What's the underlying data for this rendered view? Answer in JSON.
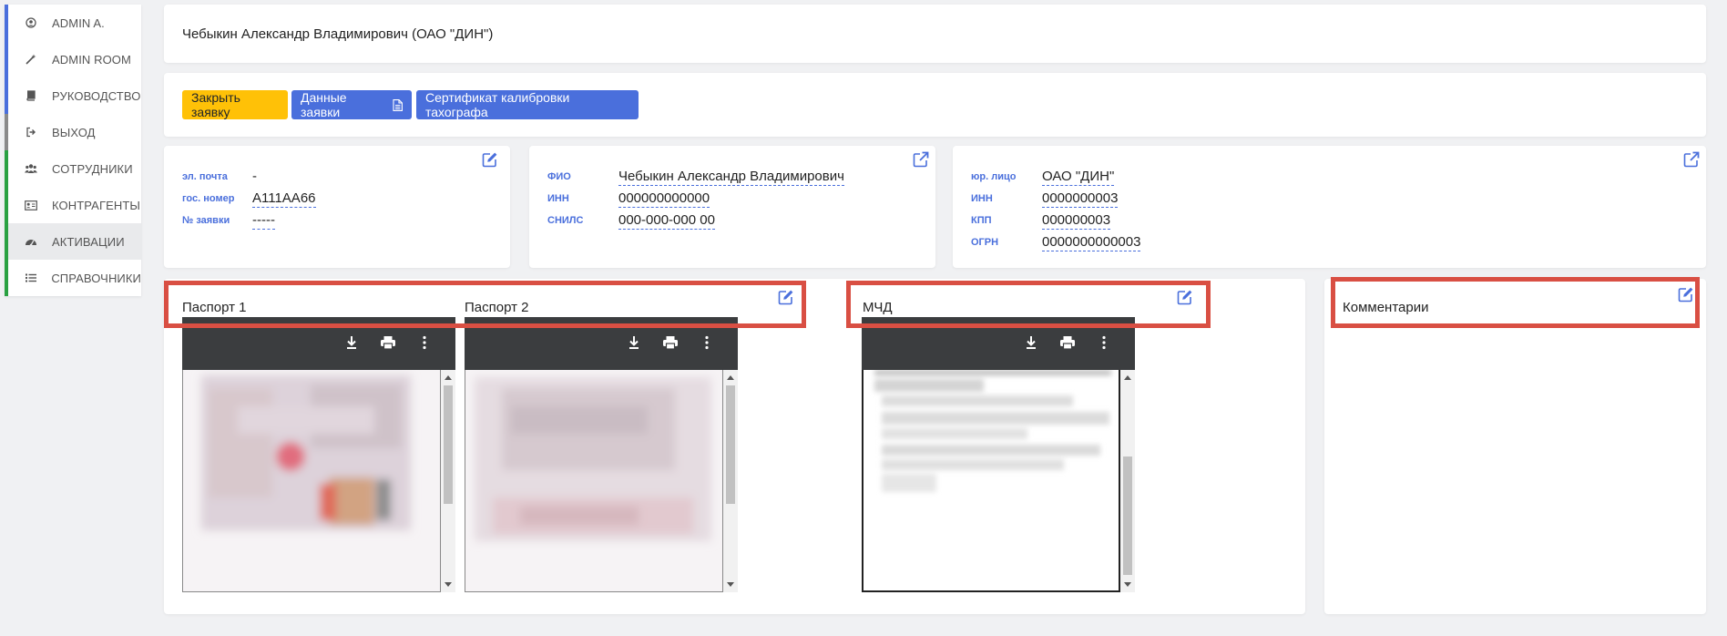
{
  "sidebar": {
    "items": [
      {
        "label": "ADMIN A.",
        "icon": "user-circle-icon",
        "bar": "#4a6fdc"
      },
      {
        "label": "ADMIN ROOM",
        "icon": "magic-wand-icon",
        "bar": "#4a6fdc"
      },
      {
        "label": "РУКОВОДСТВО",
        "icon": "book-icon",
        "bar": "#4a6fdc"
      },
      {
        "label": "ВЫХОД",
        "icon": "sign-out-icon",
        "bar": "#8a8a8a"
      },
      {
        "label": "СОТРУДНИКИ",
        "icon": "users-icon",
        "bar": "#2aa142"
      },
      {
        "label": "КОНТРАГЕНТЫ",
        "icon": "id-card-icon",
        "bar": "#2aa142"
      },
      {
        "label": "АКТИВАЦИИ",
        "icon": "dashboard-icon",
        "bar": "#2aa142",
        "active": true
      },
      {
        "label": "СПРАВОЧНИКИ",
        "icon": "list-icon",
        "bar": "#2aa142"
      }
    ]
  },
  "header": {
    "title": "Чебыкин Александр Владимирович (ОАО \"ДИН\")"
  },
  "actions": {
    "close_label": "Закрыть заявку",
    "data_label": "Данные заявки",
    "cert_label": "Сертификат калибровки тахографа"
  },
  "contact": {
    "email_label": "эл. почта",
    "email_value": "-",
    "plate_label": "гос. номер",
    "plate_value": "А111АА66",
    "request_label": "№ заявки",
    "request_value": "-----"
  },
  "person": {
    "fio_label": "ФИО",
    "fio_value": "Чебыкин Александр Владимирович",
    "inn_label": "ИНН",
    "inn_value": "000000000000",
    "snils_label": "СНИЛС",
    "snils_value": "000-000-000 00"
  },
  "company": {
    "name_label": "юр. лицо",
    "name_value": "ОАО \"ДИН\"",
    "inn_label": "ИНН",
    "inn_value": "0000000003",
    "kpp_label": "КПП",
    "kpp_value": "000000003",
    "ogrn_label": "ОГРН",
    "ogrn_value": "0000000000003"
  },
  "documents": {
    "passport1_label": "Паспорт 1",
    "passport2_label": "Паспорт 2",
    "mchd_label": "МЧД"
  },
  "comments": {
    "label": "Комментарии"
  },
  "colors": {
    "accent": "#4a6fdc",
    "warning": "#ffc107",
    "highlight": "#d94f43",
    "viewer_toolbar": "#3b3d3f"
  }
}
